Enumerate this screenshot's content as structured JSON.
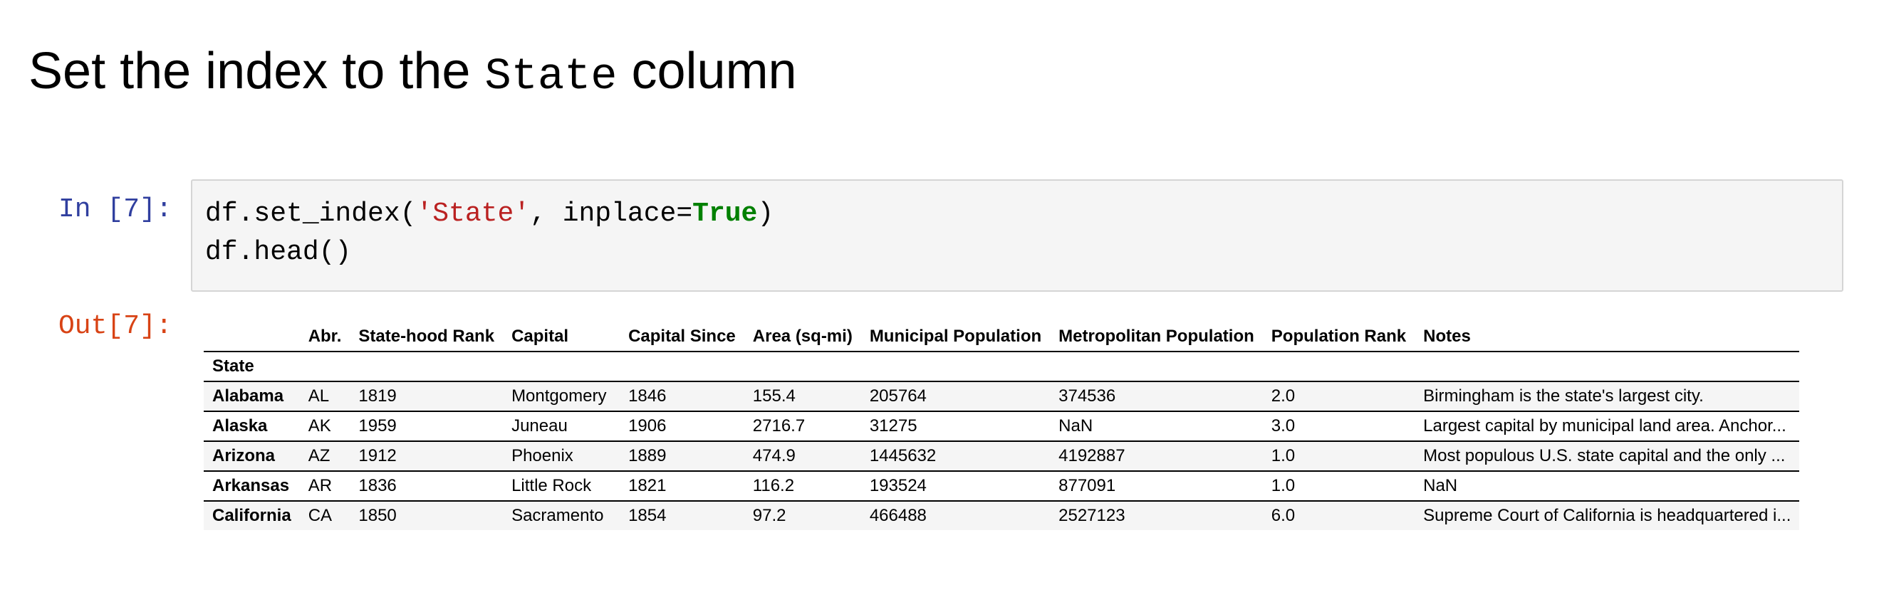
{
  "heading": {
    "before": "Set the index to the",
    "code": "State",
    "after": "column"
  },
  "cell": {
    "in_prompt": "In [7]:",
    "out_prompt": "Out[7]:",
    "code": {
      "line1": {
        "prefix": "df.set_index(",
        "string": "'State'",
        "middle": ", inplace=",
        "keyword": "True",
        "suffix": ")"
      },
      "line2": "df.head()"
    }
  },
  "table": {
    "columns": [
      "Abr.",
      "State-hood Rank",
      "Capital",
      "Capital Since",
      "Area (sq-mi)",
      "Municipal Population",
      "Metropolitan Population",
      "Population Rank",
      "Notes"
    ],
    "index_name": "State",
    "rows": [
      {
        "index": "Alabama",
        "values": [
          "AL",
          "1819",
          "Montgomery",
          "1846",
          "155.4",
          "205764",
          "374536",
          "2.0",
          "Birmingham is the state's largest city."
        ]
      },
      {
        "index": "Alaska",
        "values": [
          "AK",
          "1959",
          "Juneau",
          "1906",
          "2716.7",
          "31275",
          "NaN",
          "3.0",
          "Largest capital by municipal land area. Anchor..."
        ]
      },
      {
        "index": "Arizona",
        "values": [
          "AZ",
          "1912",
          "Phoenix",
          "1889",
          "474.9",
          "1445632",
          "4192887",
          "1.0",
          "Most populous U.S. state capital and the only ..."
        ]
      },
      {
        "index": "Arkansas",
        "values": [
          "AR",
          "1836",
          "Little Rock",
          "1821",
          "116.2",
          "193524",
          "877091",
          "1.0",
          "NaN"
        ]
      },
      {
        "index": "California",
        "values": [
          "CA",
          "1850",
          "Sacramento",
          "1854",
          "97.2",
          "466488",
          "2527123",
          "6.0",
          "Supreme Court of California is headquartered i..."
        ]
      }
    ]
  },
  "colors": {
    "in_prompt": "#303f9f",
    "out_prompt": "#d84315",
    "string": "#ba2121",
    "keyword": "#008000",
    "input_background": "#f5f5f5"
  }
}
